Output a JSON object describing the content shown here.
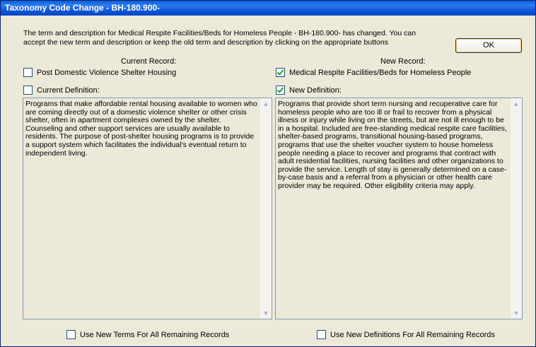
{
  "window": {
    "title": "Taxonomy Code Change - BH-180.900-",
    "message": "The term and description for Medical Respite Facilities/Beds for Homeless People - BH-180.900-  has changed.  You can accept the new term and description or keep the old term and description by clicking on the appropriate buttons",
    "ok_label": "OK"
  },
  "current": {
    "header": "Current Record:",
    "term_label": "Post Domestic Violence Shelter Housing",
    "term_checked": false,
    "definition_label": "Current Definition:",
    "definition_checked": false,
    "definition_text": "Programs that make affordable rental housing available to women who are coming directly out of a domestic violence shelter or other crisis shelter, often in apartment complexes owned by the shelter. Counseling and other support services are usually available to residents. The purpose of post-shelter housing programs is to provide a support system which facilitates the individual's eventual return to independent living."
  },
  "new": {
    "header": "New Record:",
    "term_label": "Medical Respite Facilities/Beds for Homeless People",
    "term_checked": true,
    "definition_label": "New Definition:",
    "definition_checked": true,
    "definition_text": "Programs that provide short term nursing and recuperative care for homeless people who are too ill or frail to recover from a physical illness or injury while living on the streets, but are not ill enough to be in a hospital. Included are free-standing medical respite care facilities, shelter-based programs, transitional housing-based programs, programs that use the shelter voucher system to house homeless people needing a place to recover and programs that contract with adult residential facilities, nursing facilities and other organizations to provide the service. Length of stay is generally determined on a case-by-case basis and a referral from a physician or other health care provider may be required. Other eligibility criteria may apply."
  },
  "footer": {
    "use_new_terms_label": "Use New Terms For All Remaining Records",
    "use_new_terms_checked": false,
    "use_new_definitions_label": "Use New Definitions For All Remaining Records",
    "use_new_definitions_checked": false
  },
  "colors": {
    "titlebar": "#0a5fd8",
    "dialog_bg": "#ece9d8",
    "check": "#21a121"
  }
}
